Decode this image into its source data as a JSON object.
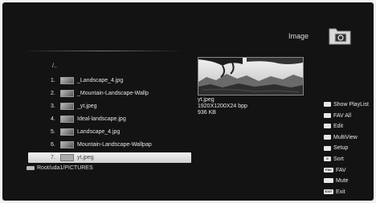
{
  "header": {
    "title": "Image",
    "folder_icon": "image-folder-icon"
  },
  "file_list": {
    "parent": "/..",
    "items": [
      {
        "num": "1.",
        "name": "_Landscape_4.jpg"
      },
      {
        "num": "2.",
        "name": "_Mountain-Landscape-Wallp"
      },
      {
        "num": "3.",
        "name": "_yt.jpeg"
      },
      {
        "num": "4.",
        "name": "Ideal-landscape.jpg"
      },
      {
        "num": "5.",
        "name": "Landscape_4.jpg"
      },
      {
        "num": "6.",
        "name": "Mountain-Landscape-Wallpap"
      },
      {
        "num": "7.",
        "name": "yt.jpeg",
        "selected": true
      }
    ]
  },
  "path": "Root/uda1/PICTURES",
  "file_info": {
    "name": "yt.jpeg",
    "dimensions": "1920X1200X24 bpp",
    "size": "936 KB"
  },
  "menu": [
    {
      "key": "",
      "label": "Show PlayList"
    },
    {
      "key": "",
      "label": "FAV All"
    },
    {
      "key": "",
      "label": "Edit"
    },
    {
      "key": "",
      "label": "MultiView"
    },
    {
      "key": "",
      "label": "Setup"
    },
    {
      "key": "0",
      "label": "Sort"
    },
    {
      "key": "FAV",
      "label": "FAV"
    },
    {
      "key": "",
      "label": "Mute"
    },
    {
      "key": "EXIT",
      "label": "Exit"
    }
  ]
}
